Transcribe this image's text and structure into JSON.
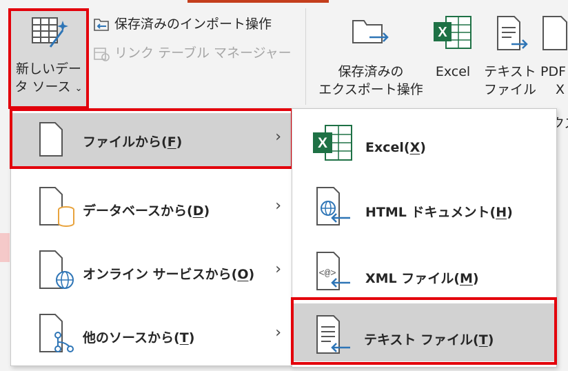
{
  "ribbon": {
    "new_source": {
      "line1": "新しいデー",
      "line2": "タ ソース",
      "chevron": "⌄"
    },
    "saved_imports": "保存済みのインポート操作",
    "linked_table_manager": "リンク テーブル マネージャー",
    "saved_exports": {
      "line1": "保存済みの",
      "line2": "エクスポート操作"
    },
    "excel": "Excel",
    "text_file": {
      "line1": "テキスト",
      "line2": "ファイル"
    },
    "pdf": {
      "line1": "PDF",
      "line2": "X"
    },
    "group_partial": "クス"
  },
  "menu_main": {
    "items": [
      {
        "label": "ファイルから(",
        "key": "F",
        "close": ")",
        "arrow": "›"
      },
      {
        "label": "データベースから(",
        "key": "D",
        "close": ")",
        "arrow": "›"
      },
      {
        "label": "オンライン サービスから(",
        "key": "O",
        "close": ")",
        "arrow": "›"
      },
      {
        "label": "他のソースから(",
        "key": "T",
        "close": ")",
        "arrow": "›"
      }
    ]
  },
  "menu_sub": {
    "items": [
      {
        "label": "Excel(",
        "key": "X",
        "close": ")"
      },
      {
        "label": "HTML ドキュメント(",
        "key": "H",
        "close": ")"
      },
      {
        "label": "XML ファイル(",
        "key": "M",
        "close": ")"
      },
      {
        "label": "テキスト ファイル(",
        "key": "T",
        "close": ")"
      }
    ]
  },
  "colors": {
    "highlight": "#e3000b",
    "excel_green": "#1e7145",
    "accent_blue": "#2e75b6",
    "db_orange": "#e8a33d"
  }
}
